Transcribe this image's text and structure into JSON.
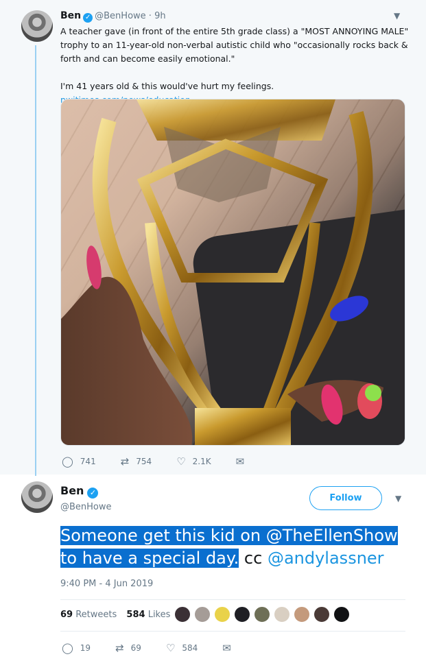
{
  "parent_tweet": {
    "name": "Ben",
    "handle": "@BenHowe",
    "time": "9h",
    "text_1": "A teacher gave (in front of the entire 5th grade class) a \"MOST ANNOYING MALE\" trophy to an 11-year-old non-verbal autistic child who \"occasionally rocks back & forth and can become easily emotional.\"",
    "text_2": "I'm 41 years old & this would've hurt my feelings.",
    "link": "nwitimes.com/news/education...",
    "replies": "741",
    "retweets": "754",
    "likes": "2.1K"
  },
  "main_tweet": {
    "name": "Ben",
    "handle": "@BenHowe",
    "follow_label": "Follow",
    "text_selected": "Someone get this kid on @TheEllenShow to have a special day.",
    "text_cc": " cc ",
    "text_mention": "@andylassner",
    "timestamp": "9:40 PM - 4 Jun 2019",
    "retweet_count": "69",
    "retweet_label": "Retweets",
    "like_count": "584",
    "like_label": "Likes",
    "replies": "19",
    "retweets": "69",
    "likes": "584"
  },
  "icons": {
    "reply": "reply-icon",
    "retweet": "retweet-icon",
    "like": "heart-icon",
    "dm": "envelope-icon",
    "verified": "verified-badge-icon",
    "more": "chevron-down-icon"
  },
  "colors": {
    "accent": "#1da1f2",
    "link": "#1b95e0",
    "selection": "#0a6fcf",
    "thread_line": "#9ad0f2"
  }
}
